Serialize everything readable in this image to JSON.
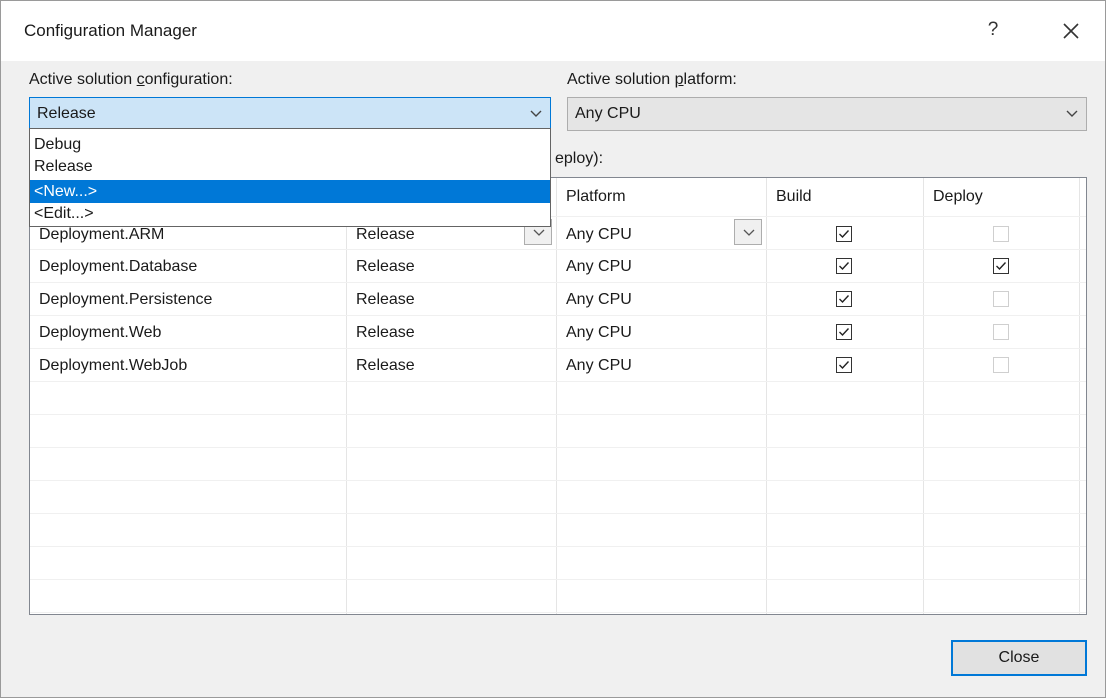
{
  "window": {
    "title": "Configuration Manager",
    "help_label": "?"
  },
  "active_config": {
    "label_pre": "Active solution ",
    "label_key": "c",
    "label_post": "onfiguration:",
    "value": "Release",
    "options": [
      "Debug",
      "Release",
      "<New...>",
      "<Edit...>"
    ],
    "highlighted_option": "<New...>"
  },
  "active_platform": {
    "label_pre": "Active solution ",
    "label_key": "p",
    "label_post": "latform:",
    "value": "Any CPU"
  },
  "contexts_label_fragment": "eploy):",
  "grid": {
    "columns": [
      "Platform",
      "Build",
      "Deploy"
    ],
    "rows": [
      {
        "project": "Deployment.ARM",
        "configuration": "Release",
        "platform": "Any CPU",
        "build": true,
        "deploy": false,
        "deploy_enabled": false
      },
      {
        "project": "Deployment.Database",
        "configuration": "Release",
        "platform": "Any CPU",
        "build": true,
        "deploy": true,
        "deploy_enabled": true
      },
      {
        "project": "Deployment.Persistence",
        "configuration": "Release",
        "platform": "Any CPU",
        "build": true,
        "deploy": false,
        "deploy_enabled": false
      },
      {
        "project": "Deployment.Web",
        "configuration": "Release",
        "platform": "Any CPU",
        "build": true,
        "deploy": false,
        "deploy_enabled": false
      },
      {
        "project": "Deployment.WebJob",
        "configuration": "Release",
        "platform": "Any CPU",
        "build": true,
        "deploy": false,
        "deploy_enabled": false
      }
    ]
  },
  "buttons": {
    "close_label": "Close"
  },
  "colors": {
    "accent": "#0078d7",
    "combo_active_bg": "#cce4f7",
    "dialog_bg": "#f0f0f0"
  }
}
